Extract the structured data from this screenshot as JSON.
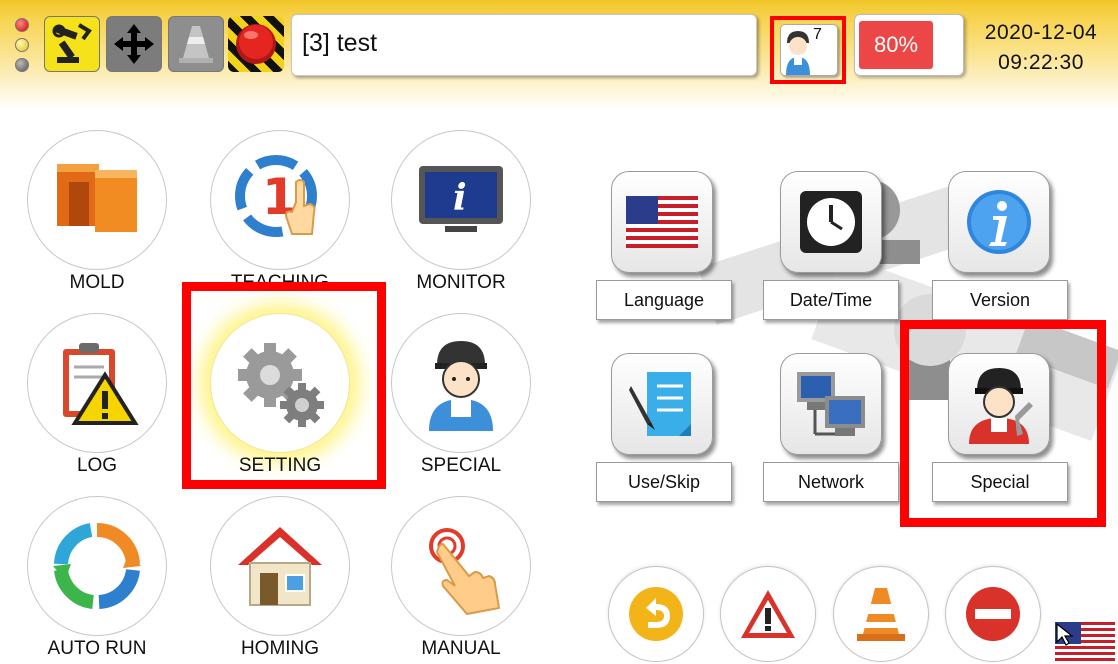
{
  "topbar": {
    "lamps": [
      "red",
      "yellow",
      "gray"
    ],
    "tools": [
      {
        "name": "robot-arm-icon",
        "color": "#f6e21a"
      },
      {
        "name": "move-arrows-icon",
        "color": "#7c7c7c"
      },
      {
        "name": "traffic-cone-icon",
        "color": "#8e8e8e"
      },
      {
        "name": "emergency-stop-icon",
        "color": "#e52620"
      }
    ],
    "program_title": "[3] test",
    "user_level": "7",
    "battery_percent": "80%",
    "battery_level": 0.8,
    "date": "2020-12-04",
    "time": "09:22:30"
  },
  "menu": {
    "mold": "MOLD",
    "teaching": "TEACHING",
    "monitor": "MONITOR",
    "log": "LOG",
    "setting": "SETTING",
    "special": "SPECIAL",
    "auto_run": "AUTO RUN",
    "homing": "HOMING",
    "manual": "MANUAL"
  },
  "settings_panel": {
    "language": "Language",
    "datetime": "Date/Time",
    "version": "Version",
    "useskip": "Use/Skip",
    "network": "Network",
    "special": "Special"
  },
  "bottom_buttons": [
    "back-icon",
    "alarm-warning-icon",
    "traffic-cone-icon",
    "stop-icon"
  ],
  "colors": {
    "topbar": "#f2c62a",
    "highlight": "#ff0000",
    "battery": "#ec4646"
  }
}
